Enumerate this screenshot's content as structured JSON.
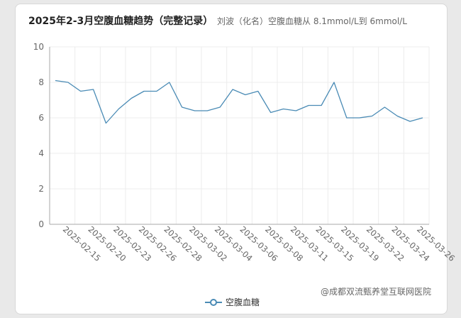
{
  "chart_data": {
    "type": "line",
    "title": "2025年2-3月空腹血糖趋势（完整记录）",
    "subtitle": "刘波（化名）空腹血糖从 8.1mmol/L到 6mmol/L",
    "watermark": "@成都双流甄养堂互联网医院",
    "series": [
      {
        "name": "空腹血糖",
        "color": "#4a8bb5",
        "values": [
          8.1,
          8.0,
          7.5,
          7.6,
          5.7,
          6.5,
          7.1,
          7.5,
          7.5,
          8.0,
          6.6,
          6.4,
          6.4,
          6.6,
          7.6,
          7.3,
          7.5,
          6.3,
          6.5,
          6.4,
          6.7,
          6.7,
          8.0,
          6.0,
          6.0,
          6.1,
          6.6,
          6.1,
          5.8,
          6.0
        ]
      }
    ],
    "x_tick_labels": [
      "2025-02-15",
      "2025-02-20",
      "2025-02-23",
      "2025-02-26",
      "2025-02-28",
      "2025-03-02",
      "2025-03-04",
      "2025-03-06",
      "2025-03-08",
      "2025-03-11",
      "2025-03-15",
      "2025-03-19",
      "2025-03-22",
      "2025-03-24",
      "2025-03-26"
    ],
    "y_ticks": [
      0,
      2,
      4,
      6,
      8,
      10
    ],
    "ylim": [
      0,
      10
    ],
    "grid": true,
    "legend_position": "bottom-center"
  }
}
